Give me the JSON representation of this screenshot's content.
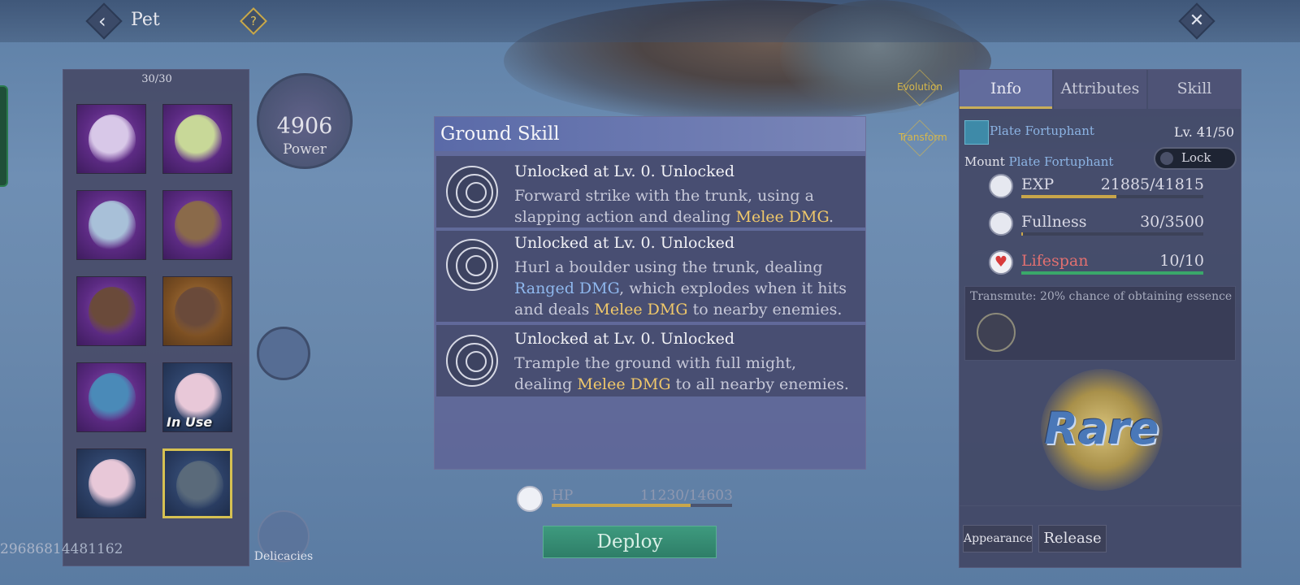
{
  "header": {
    "title": "Pet",
    "help_glyph": "?",
    "close_glyph": "✕",
    "back_glyph": "‹"
  },
  "pet_list": {
    "count": "30/30",
    "slots": [
      {
        "name": "pet-slot-1",
        "bg": "purple",
        "art": "#d8c8e8"
      },
      {
        "name": "pet-slot-2",
        "bg": "purple",
        "art": "#c8d898"
      },
      {
        "name": "pet-slot-3",
        "bg": "purple",
        "art": "#a8c0d8"
      },
      {
        "name": "pet-slot-4",
        "bg": "purple",
        "art": "#8a6a4a"
      },
      {
        "name": "pet-slot-5",
        "bg": "purple",
        "art": "#6a4a3a"
      },
      {
        "name": "pet-slot-6",
        "bg": "orange",
        "art": "#6a4a3a"
      },
      {
        "name": "pet-slot-7",
        "bg": "purple",
        "art": "#4a8ab8"
      },
      {
        "name": "pet-slot-8",
        "bg": "blue",
        "art": "#e8c8d8",
        "in_use": "In Use"
      },
      {
        "name": "pet-slot-9",
        "bg": "blue",
        "art": "#e8c8d8"
      },
      {
        "name": "pet-slot-10",
        "bg": "blue",
        "art": "#5a6a7a",
        "selected": true
      }
    ]
  },
  "power": {
    "value": "4906",
    "label": "Power"
  },
  "delicacies_label": "Delicacies",
  "uid": "29686814481162",
  "evolution_label": "Evolution",
  "transform_label": "Transform",
  "skill_popup": {
    "title": "Ground Skill",
    "skills": [
      {
        "unlock": "Unlocked at Lv. 0.   Unlocked",
        "desc_parts": [
          {
            "text": "Forward strike with the trunk, using a slapping action and dealing ",
            "kw": ""
          },
          {
            "text": "Melee DMG",
            "kw": "melee"
          },
          {
            "text": ".",
            "kw": ""
          }
        ]
      },
      {
        "unlock": "Unlocked at Lv. 0.   Unlocked",
        "desc_parts": [
          {
            "text": "Hurl a boulder using the trunk, dealing ",
            "kw": ""
          },
          {
            "text": "Ranged DMG",
            "kw": "ranged"
          },
          {
            "text": ", which explodes when it hits and deals ",
            "kw": ""
          },
          {
            "text": "Melee DMG",
            "kw": "melee"
          },
          {
            "text": " to nearby enemies.",
            "kw": ""
          }
        ]
      },
      {
        "unlock": "Unlocked at Lv. 0.   Unlocked",
        "desc_parts": [
          {
            "text": "Trample the ground with full might, dealing ",
            "kw": ""
          },
          {
            "text": "Melee DMG",
            "kw": "melee"
          },
          {
            "text": " to all nearby enemies.",
            "kw": ""
          }
        ]
      }
    ]
  },
  "hp": {
    "label": "HP",
    "value": "11230/14603",
    "fraction": 0.769
  },
  "deploy_label": "Deploy",
  "info_panel": {
    "tabs": [
      "Info",
      "Attributes",
      "Skill"
    ],
    "active_tab": 0,
    "pet_name": "Plate Fortuphant",
    "level": "Lv. 41/50",
    "mount_label": "Mount ",
    "mount_value": "Plate Fortuphant",
    "lock_label": "Lock",
    "stats": [
      {
        "label": "EXP",
        "value": "21885/41815",
        "fraction": 0.523,
        "color": "#c9a64a",
        "icon": "exp-icon"
      },
      {
        "label": "Fullness",
        "value": "30/3500",
        "fraction": 0.009,
        "color": "#c9a64a",
        "icon": "fullness-icon"
      },
      {
        "label": "Lifespan",
        "value": "10/10",
        "fraction": 1.0,
        "color": "#3aa86a",
        "icon": "heart-icon"
      }
    ],
    "transmute_text": "Transmute: 20% chance of obtaining essence",
    "rarity": "Rare",
    "appearance_label": "Appearance",
    "release_label": "Release"
  }
}
